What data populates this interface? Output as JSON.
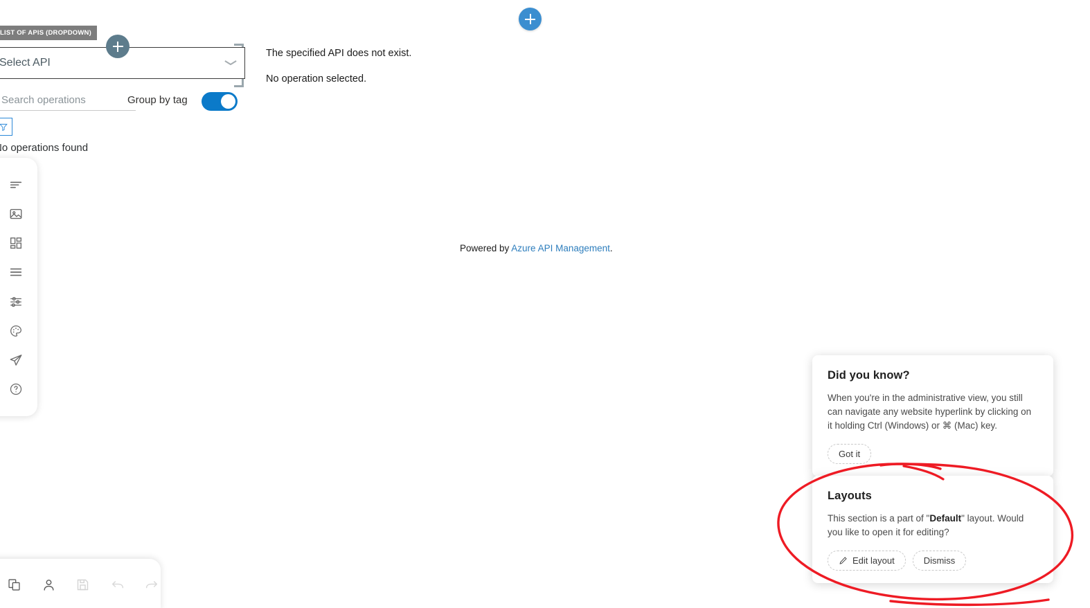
{
  "chip": {
    "label": "LIST OF APIS (DROPDOWN)"
  },
  "widgets": {
    "add_button_center_label": "+",
    "add_button_inline_label": "+"
  },
  "api_panel": {
    "select": {
      "value": "Select API",
      "chevron_icon": "chevron-down-icon"
    },
    "search": {
      "placeholder": "Search operations",
      "value": ""
    },
    "group_by_tag_label": "Group by tag",
    "group_by_tag_state": "on",
    "filter_icon": "filter-icon",
    "empty_state": "No operations found"
  },
  "content": {
    "message_api": "The specified API does not exist.",
    "message_operation": "No operation selected.",
    "footer_prefix": "Powered by ",
    "footer_link": "Azure API Management",
    "footer_suffix": "."
  },
  "rail": {
    "items": [
      {
        "name": "pages-icon",
        "label": "Pages"
      },
      {
        "name": "media-icon",
        "label": "Media"
      },
      {
        "name": "widgets-icon",
        "label": "Widgets"
      },
      {
        "name": "navigation-icon",
        "label": "Navigation"
      },
      {
        "name": "settings-icon",
        "label": "Settings"
      },
      {
        "name": "styles-palette-icon",
        "label": "Styles"
      },
      {
        "name": "publish-icon",
        "label": "Publish"
      },
      {
        "name": "help-icon",
        "label": "Help"
      }
    ]
  },
  "bottombar": {
    "items": [
      {
        "name": "duplicate-icon",
        "label": "Duplicate",
        "enabled": true
      },
      {
        "name": "user-icon",
        "label": "Profile",
        "enabled": true
      },
      {
        "name": "save-icon",
        "label": "Save",
        "enabled": false
      },
      {
        "name": "undo-icon",
        "label": "Undo",
        "enabled": false
      },
      {
        "name": "redo-icon",
        "label": "Redo",
        "enabled": false
      }
    ]
  },
  "cards": {
    "did_you_know": {
      "title": "Did you know?",
      "body": "When you're in the administrative view, you still can navigate any website hyperlink by clicking on it holding Ctrl (Windows) or ⌘ (Mac) key.",
      "primary_label": "Got it"
    },
    "layouts": {
      "title": "Layouts",
      "body_prefix": "This section is a part of \"",
      "body_bold": "Default",
      "body_suffix": "\" layout. Would you like to open it for editing?",
      "edit_label": "Edit layout",
      "edit_icon": "pencil-icon",
      "dismiss_label": "Dismiss"
    }
  },
  "colors": {
    "accent_blue": "#0b7ac9",
    "add_blue": "#3b8ed0",
    "add_grey": "#5d7c8c",
    "link_blue": "#2e7ebd",
    "annotation_red": "#ee1b24",
    "chip_grey": "#7d7d7d"
  }
}
